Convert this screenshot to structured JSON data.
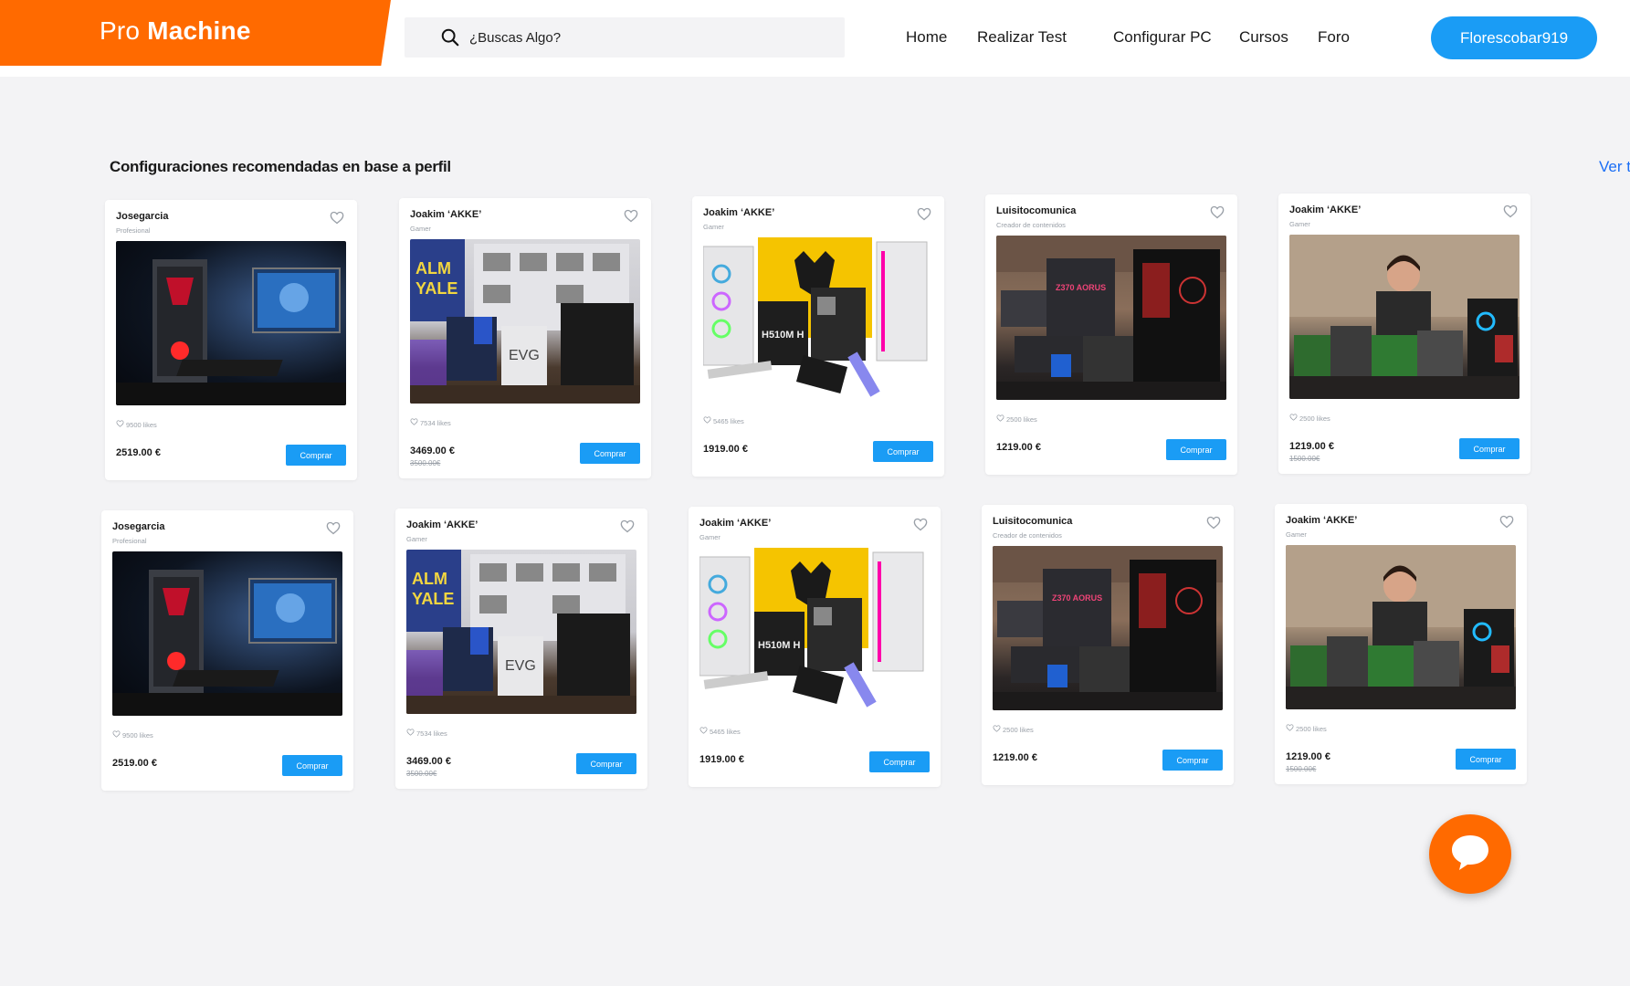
{
  "header": {
    "logo_light": "Pro",
    "logo_bold": "Machine",
    "search_placeholder": "¿Buscas Algo?",
    "nav": [
      "Home",
      "Realizar Test",
      "Configurar PC",
      "Cursos",
      "Foro"
    ],
    "user_button": "Florescobar919"
  },
  "section": {
    "title": "Configuraciones recomendadas en base a perfil",
    "see_all": "Ver t"
  },
  "cards": [
    {
      "author": "Josegarcia",
      "role": "Profesional",
      "likes": "9500 likes",
      "price": "2519.00 €",
      "old_price": "",
      "buy": "Comprar",
      "image": "gaming-pc-setup"
    },
    {
      "author": "Joakim ‘AKKE’",
      "role": "Gamer",
      "likes": "7534 likes",
      "price": "3469.00 €",
      "old_price": "3500.00€",
      "buy": "Comprar",
      "image": "realm-royale-workshop"
    },
    {
      "author": "Joakim ‘AKKE’",
      "role": "Gamer",
      "likes": "5465 likes",
      "price": "1919.00 €",
      "old_price": "",
      "buy": "Comprar",
      "image": "white-pc-components"
    },
    {
      "author": "Luisitocomunica",
      "role": "Creador de contenidos",
      "likes": "2500 likes",
      "price": "1219.00 €",
      "old_price": "",
      "buy": "Comprar",
      "image": "aorus-desk-build"
    },
    {
      "author": "Joakim ‘AKKE’",
      "role": "Gamer",
      "likes": "2500 likes",
      "price": "1219.00 €",
      "old_price": "1500.00€",
      "buy": "Comprar",
      "image": "person-with-components"
    },
    {
      "author": "Josegarcia",
      "role": "Profesional",
      "likes": "9500 likes",
      "price": "2519.00 €",
      "old_price": "",
      "buy": "Comprar",
      "image": "gaming-pc-setup"
    },
    {
      "author": "Joakim ‘AKKE’",
      "role": "Gamer",
      "likes": "7534 likes",
      "price": "3469.00 €",
      "old_price": "3500.00€",
      "buy": "Comprar",
      "image": "realm-royale-workshop"
    },
    {
      "author": "Joakim ‘AKKE’",
      "role": "Gamer",
      "likes": "5465 likes",
      "price": "1919.00 €",
      "old_price": "",
      "buy": "Comprar",
      "image": "white-pc-components"
    },
    {
      "author": "Luisitocomunica",
      "role": "Creador de contenidos",
      "likes": "2500 likes",
      "price": "1219.00 €",
      "old_price": "",
      "buy": "Comprar",
      "image": "aorus-desk-build"
    },
    {
      "author": "Joakim ‘AKKE’",
      "role": "Gamer",
      "likes": "2500 likes",
      "price": "1219.00 €",
      "old_price": "1500.00€",
      "buy": "Comprar",
      "image": "person-with-components"
    }
  ],
  "colors": {
    "brand_orange": "#ff6a00",
    "accent_blue": "#1a9cf5",
    "link_blue": "#1a6ef5",
    "background": "#f3f3f5"
  },
  "icons": [
    "search-icon",
    "heart-icon",
    "chat-icon"
  ]
}
